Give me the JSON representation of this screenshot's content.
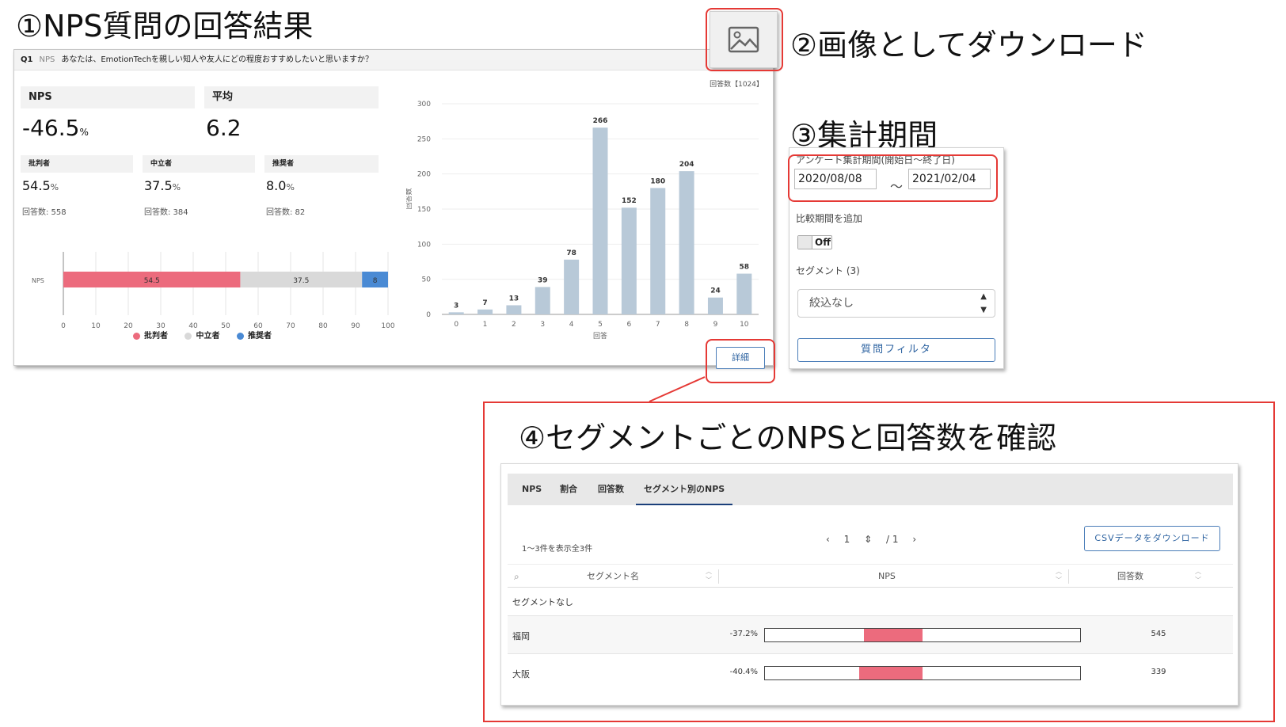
{
  "headings": {
    "h1": "①NPS質問の回答結果",
    "h2": "②画像としてダウンロード",
    "h3": "③集計期間",
    "h4": "④セグメントごとのNPSと回答数を確認"
  },
  "question": {
    "number": "Q1",
    "tag": "NPS",
    "text": "あなたは、EmotionTechを親しい知人や友人にどの程度おすすめしたいと思いますか？",
    "response_count": "回答数【1024】"
  },
  "stats": {
    "nps_label": "NPS",
    "nps_value": "-46.5",
    "pct_unit": "%",
    "avg_label": "平均",
    "avg_value": "6.2",
    "detractor_label": "批判者",
    "detractor_value": "54.5",
    "detractor_count": "回答数: 558",
    "passive_label": "中立者",
    "passive_value": "37.5",
    "passive_count": "回答数: 384",
    "promoter_label": "推奨者",
    "promoter_value": "8.0",
    "promoter_count": "回答数: 82"
  },
  "detail_button": "詳細",
  "colors": {
    "detractor": "#ec6b7d",
    "passive": "#d9d9d9",
    "promoter": "#4a8ad4",
    "bar": "#b8c9d8",
    "highlight": "#e53935"
  },
  "chart_data": [
    {
      "type": "bar",
      "orientation": "horizontal-stacked",
      "categories": [
        "NPS"
      ],
      "series": [
        {
          "name": "批判者",
          "values": [
            54.5
          ],
          "label": "54.5"
        },
        {
          "name": "中立者",
          "values": [
            37.5
          ],
          "label": "37.5"
        },
        {
          "name": "推奨者",
          "values": [
            8.0
          ],
          "label": "8"
        }
      ],
      "xlim": [
        0,
        100
      ],
      "xticks": [
        0,
        10,
        20,
        30,
        40,
        50,
        60,
        70,
        80,
        90,
        100
      ],
      "legend": "bottom"
    },
    {
      "type": "bar",
      "categories": [
        "0",
        "1",
        "2",
        "3",
        "4",
        "5",
        "6",
        "7",
        "8",
        "9",
        "10"
      ],
      "values": [
        3,
        7,
        13,
        39,
        78,
        266,
        152,
        180,
        204,
        24,
        58
      ],
      "xlabel": "回答",
      "ylabel": "回答数",
      "ylim": [
        0,
        300
      ],
      "yticks": [
        0,
        50,
        100,
        150,
        200,
        250,
        300
      ]
    }
  ],
  "period": {
    "label": "アンケート集計期間(開始日～終了日)",
    "start": "2020/08/08",
    "tilde": "～",
    "end": "2021/02/04",
    "compare_label": "比較期間を追加",
    "toggle": "Off",
    "segment_label": "セグメント (3)",
    "segment_value": "絞込なし",
    "filter_button": "質問フィルタ"
  },
  "segments": {
    "tabs": [
      "NPS",
      "割合",
      "回答数",
      "セグメント別のNPS"
    ],
    "range_text": "1～3件を表示全3件",
    "page_current": "1",
    "page_total": "/ 1",
    "csv_button": "CSVデータをダウンロード",
    "columns": [
      "セグメント名",
      "NPS",
      "回答数"
    ],
    "rows": [
      {
        "name": "セグメントなし",
        "nps": "",
        "nps_value": null,
        "count": ""
      },
      {
        "name": "福岡",
        "nps": "-37.2%",
        "nps_value": -37.2,
        "count": "545"
      },
      {
        "name": "大阪",
        "nps": "-40.4%",
        "nps_value": -40.4,
        "count": "339"
      }
    ]
  }
}
